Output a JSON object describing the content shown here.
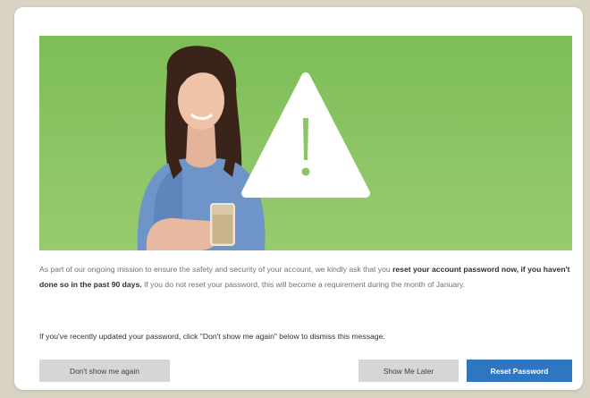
{
  "dialog": {
    "hero_image": "woman-holding-drink-with-warning-triangle",
    "hero_color": "#8cc565",
    "warning_icon": "exclamation-triangle-icon",
    "message": {
      "intro": "As part of our ongoing mission to ensure the safety and security of your account, we kindly ask that you ",
      "emphasis": "reset your account password now, if you haven't done so in the past 90 days.",
      "outro": " If you do not reset your password, this will become a requirement during the month of January."
    },
    "note": "If you've recently updated your password, click \"Don't show me again\" below to dismiss this message."
  },
  "buttons": {
    "dont_show": "Don't show me again",
    "show_later": "Show Me Later",
    "reset": "Reset Password",
    "primary_color": "#2e76c2"
  }
}
